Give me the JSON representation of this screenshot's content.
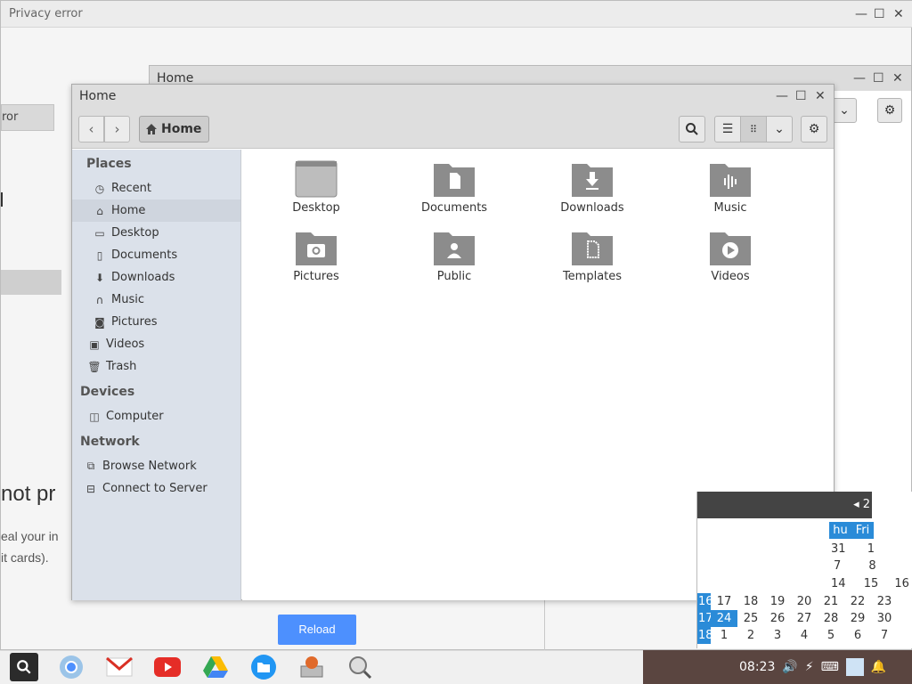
{
  "background_window": {
    "title": "Privacy error",
    "side_fragment": "ror",
    "heading_fragment": "not pr",
    "line1_fragment": "eal your in",
    "line2_fragment": "it cards).",
    "reload_label": "Reload"
  },
  "second_window": {
    "title": "Home"
  },
  "file_manager": {
    "title": "Home",
    "path_label": "Home",
    "sidebar": {
      "places_header": "Places",
      "places": [
        {
          "label": "Recent",
          "icon": "clock-icon"
        },
        {
          "label": "Home",
          "icon": "home-icon"
        },
        {
          "label": "Desktop",
          "icon": "desktop-icon"
        },
        {
          "label": "Documents",
          "icon": "document-icon"
        },
        {
          "label": "Downloads",
          "icon": "download-icon"
        },
        {
          "label": "Music",
          "icon": "headphones-icon"
        },
        {
          "label": "Pictures",
          "icon": "camera-icon"
        },
        {
          "label": "Videos",
          "icon": "film-icon"
        },
        {
          "label": "Trash",
          "icon": "trash-icon"
        }
      ],
      "devices_header": "Devices",
      "devices": [
        {
          "label": "Computer",
          "icon": "computer-icon"
        }
      ],
      "network_header": "Network",
      "network": [
        {
          "label": "Browse Network",
          "icon": "network-icon"
        },
        {
          "label": "Connect to Server",
          "icon": "server-icon"
        }
      ]
    },
    "folders": [
      {
        "label": "Desktop"
      },
      {
        "label": "Documents"
      },
      {
        "label": "Downloads"
      },
      {
        "label": "Music"
      },
      {
        "label": "Pictures"
      },
      {
        "label": "Public"
      },
      {
        "label": "Templates"
      },
      {
        "label": "Videos"
      }
    ]
  },
  "calendar": {
    "header_fragment": "◂ 2",
    "day_headers": [
      "hu",
      "Fri"
    ],
    "rows": [
      [
        "",
        "",
        "",
        "",
        "31",
        "1"
      ],
      [
        "",
        "",
        "",
        "",
        "7",
        "8"
      ],
      [
        "16",
        "17",
        "18",
        "19",
        "20",
        "21",
        "22",
        "23"
      ]
    ],
    "row_a": [
      "31",
      "1"
    ],
    "row_b": [
      "7",
      "8"
    ],
    "row_c": [
      "14",
      "15",
      "16"
    ],
    "row_d": {
      "wk": "16",
      "days": [
        "17",
        "18",
        "19",
        "20",
        "21",
        "22",
        "23"
      ]
    },
    "row_e": {
      "wk": "17",
      "days": [
        "24",
        "25",
        "26",
        "27",
        "28",
        "29",
        "30"
      ]
    },
    "row_f": {
      "wk": "18",
      "days": [
        "1",
        "2",
        "3",
        "4",
        "5",
        "6",
        "7"
      ]
    },
    "today": "24"
  },
  "tray": {
    "time": "08:23"
  },
  "colors": {
    "accent": "#4d90fe",
    "sidebar_bg": "#dbe1ea",
    "calendar_week": "#2a8bd8"
  }
}
